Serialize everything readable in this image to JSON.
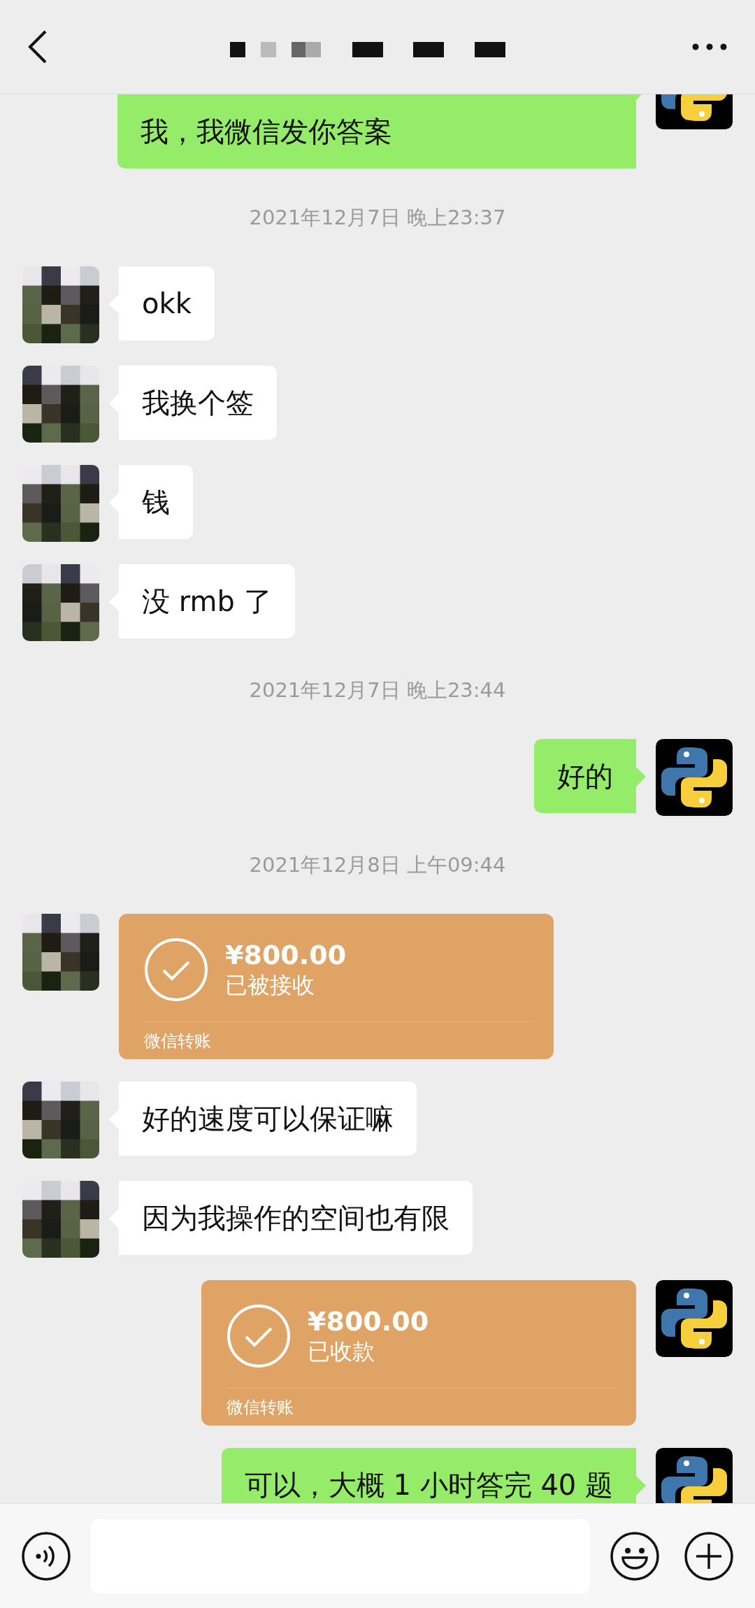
{
  "messages": [
    {
      "kind": "text",
      "outgoing": true,
      "text": "我，我微信发你答案",
      "cut_top": true
    },
    {
      "kind": "time",
      "text": "2021年12月7日 晚上23:37"
    },
    {
      "kind": "text",
      "outgoing": false,
      "text": "okk"
    },
    {
      "kind": "text",
      "outgoing": false,
      "text": "我换个签"
    },
    {
      "kind": "text",
      "outgoing": false,
      "text": "钱"
    },
    {
      "kind": "text",
      "outgoing": false,
      "text": "没 rmb 了"
    },
    {
      "kind": "time",
      "text": "2021年12月7日 晚上23:44"
    },
    {
      "kind": "text",
      "outgoing": true,
      "text": "好的"
    },
    {
      "kind": "time",
      "text": "2021年12月8日 上午09:44"
    },
    {
      "kind": "transfer",
      "outgoing": false,
      "amount": "¥800.00",
      "status": "已被接收",
      "label": "微信转账"
    },
    {
      "kind": "text",
      "outgoing": false,
      "text": "好的速度可以保证嘛"
    },
    {
      "kind": "text",
      "outgoing": false,
      "text": "因为我操作的空间也有限"
    },
    {
      "kind": "transfer",
      "outgoing": true,
      "amount": "¥800.00",
      "status": "已收款",
      "label": "微信转账"
    },
    {
      "kind": "text",
      "outgoing": true,
      "text": "可以，大概 1 小时答完 40 题"
    }
  ]
}
